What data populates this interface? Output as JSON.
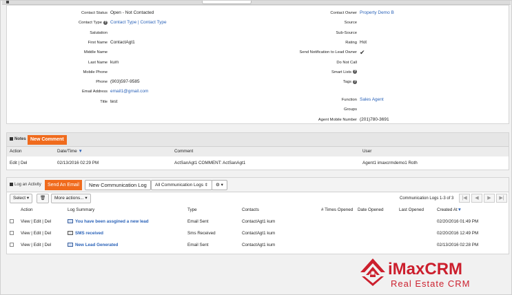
{
  "details": {
    "left": [
      {
        "label": "Contact Status",
        "value": "Open - Not Contacted",
        "link": false,
        "help": false
      },
      {
        "label": "Contact Type",
        "value": "Contact Type | Contact Type",
        "link": true,
        "help": true
      },
      {
        "label": "Salutation",
        "value": "",
        "link": false,
        "help": false
      },
      {
        "label": "First Name",
        "value": "ContactAgt1",
        "link": false,
        "help": false
      },
      {
        "label": "Middle Name",
        "value": "",
        "link": false,
        "help": false
      },
      {
        "label": "Last Name",
        "value": "kum",
        "link": false,
        "help": false
      },
      {
        "label": "Mobile Phone",
        "value": "",
        "link": false,
        "help": false
      },
      {
        "label": "Phone",
        "value": "(903)597-9585",
        "link": false,
        "help": false
      },
      {
        "label": "Email Address",
        "value": "email1@gmail.com",
        "link": true,
        "help": false
      },
      {
        "label": "Title",
        "value": "test",
        "link": false,
        "help": false
      }
    ],
    "right": [
      {
        "label": "Contact Owner",
        "value": "Property Demo B",
        "link": true,
        "help": false
      },
      {
        "label": "Source",
        "value": "",
        "link": false,
        "help": false
      },
      {
        "label": "Sub-Source",
        "value": "",
        "link": false,
        "help": false
      },
      {
        "label": "Rating",
        "value": "Hot",
        "link": false,
        "help": false
      },
      {
        "label": "Send Notification to Lead Owner",
        "value": "✔",
        "link": false,
        "help": false
      },
      {
        "label": "Do Not Call",
        "value": "",
        "link": false,
        "help": false
      },
      {
        "label": "Smart Lists",
        "value": "",
        "link": false,
        "help": true
      },
      {
        "label": "Tags",
        "value": "",
        "link": false,
        "help": true
      }
    ],
    "right2": [
      {
        "label": "Function",
        "value": "Sales Agent",
        "link": true
      },
      {
        "label": "Groups",
        "value": "",
        "link": false
      },
      {
        "label": "Agent Mobile Number",
        "value": "(201)780-3691",
        "link": false
      }
    ]
  },
  "notes": {
    "title": "Notes",
    "new_button": "New Comment",
    "columns": {
      "action": "Action",
      "datetime": "Date/Time",
      "comment": "Comment",
      "user": "User"
    },
    "sort_arrow": "▼",
    "rows": [
      {
        "action": "Edit | Del",
        "datetime": "02/13/2016 02:29 PM",
        "comment": "ActSanAgt1 COMMENT: ActSanAgt1",
        "user": "Agent1 imaxcrmdemo1 Roth"
      }
    ]
  },
  "log": {
    "title": "Log an Activity",
    "send_email": "Send An Email",
    "new_log": "New Communication Log",
    "filter": "All Communication Logs",
    "gear": "⚙ ▾",
    "select": "Select ▾",
    "trash": "🗑",
    "more_actions": "More actions... ▾",
    "pager_text": "Communication Logs 1-3 of 3",
    "pager_buttons": [
      "|◀",
      "◀",
      "▶",
      "▶|"
    ],
    "columns": {
      "action": "Action",
      "summary": "Log Summary",
      "type": "Type",
      "contacts": "Contacts",
      "times_opened": "# Times Opened",
      "date_opened": "Date Opened",
      "last_opened": "Last Opened",
      "created": "Created At"
    },
    "sort_arrow": "▼",
    "rows": [
      {
        "action": "View | Edit | Del",
        "summary": "You have been assgined a new lead",
        "icon": "envelope-icon",
        "type": "Email Sent",
        "contact": "ContactAgt1 kum",
        "created": "02/20/2016 01:49 PM"
      },
      {
        "action": "View | Edit | Del",
        "summary": "SMS received",
        "icon": "sms-icon",
        "type": "Sms Received",
        "contact": "ContactAgt1 kum",
        "created": "02/20/2016 12:49 PM"
      },
      {
        "action": "View | Edit | Del",
        "summary": "New Lead Generated",
        "icon": "envelope-icon",
        "type": "Email Sent",
        "contact": "ContactAgt1 kum",
        "created": "02/13/2016 02:28 PM"
      }
    ]
  },
  "brand": {
    "name": "iMaxCRM",
    "tagline": "Real Estate CRM",
    "color": "#cc1f2d"
  },
  "accent_orange": "#f06b1d",
  "link_blue": "#2a62b8"
}
